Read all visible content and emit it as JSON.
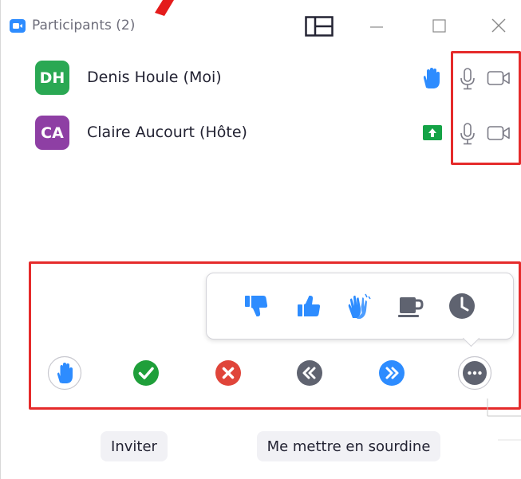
{
  "window": {
    "title": "Participants (2)",
    "controls": [
      "layout-toggle",
      "minimize",
      "maximize",
      "close"
    ]
  },
  "participants": [
    {
      "initials": "DH",
      "name": "Denis Houle (Moi)",
      "avatar_color": "#2aa853",
      "status_icon": "raised-hand-icon",
      "audio_icon": "microphone-icon",
      "video_icon": "video-camera-icon"
    },
    {
      "initials": "CA",
      "name": "Claire Aucourt (Hôte)",
      "avatar_color": "#8e3fa4",
      "status_icon": "screen-share-icon",
      "audio_icon": "microphone-icon",
      "video_icon": "video-camera-icon"
    }
  ],
  "reactions_popup": {
    "items": [
      "thumbs-down-icon",
      "thumbs-up-icon",
      "clapping-hands-icon",
      "coffee-cup-icon",
      "clock-icon"
    ]
  },
  "action_row": {
    "items": [
      "raise-hand-icon",
      "yes-check-icon",
      "no-cross-icon",
      "go-slower-icon",
      "go-faster-icon",
      "more-icon"
    ]
  },
  "footer": {
    "invite_label": "Inviter",
    "mute_label": "Me mettre en sourdine"
  },
  "colors": {
    "accent_blue": "#2d8cff",
    "highlight_red": "#e52b2b",
    "yes_green": "#1f9f3a",
    "no_red": "#e0453a",
    "neutral_gray": "#5f6370",
    "share_green": "#14a346"
  }
}
